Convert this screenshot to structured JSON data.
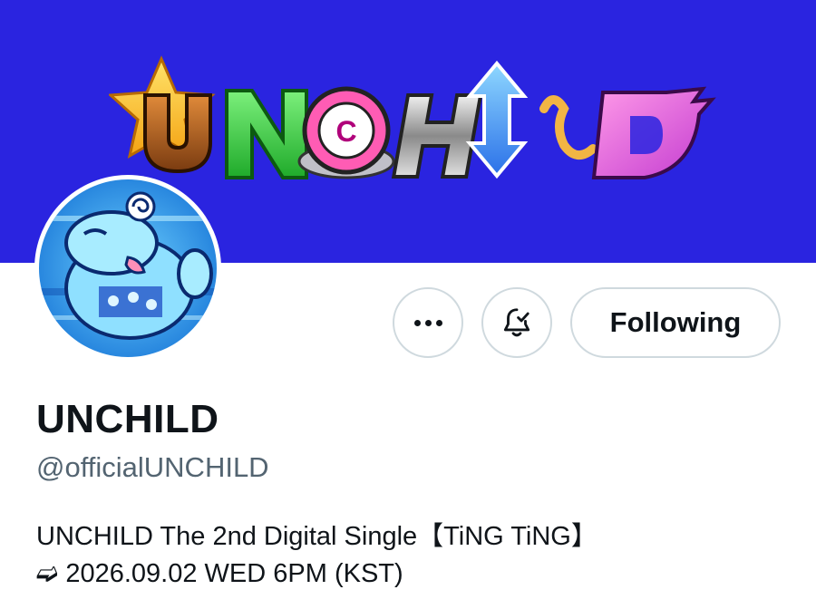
{
  "banner": {
    "logo_text": "UNCHILD",
    "background_color": "#2a24e0"
  },
  "profile": {
    "display_name": "UNCHILD",
    "handle": "@officialUNCHILD",
    "bio_line_1": "UNCHILD The 2nd Digital Single【TiNG TiNG】",
    "bio_line_2": "➫ 2026.09.02 WED 6PM (KST)"
  },
  "actions": {
    "more_icon": "more-horizontal-icon",
    "notify_icon": "bell-check-icon",
    "following_label": "Following"
  },
  "colors": {
    "text_primary": "#0f1419",
    "text_secondary": "#536471",
    "border": "#cfd9de"
  }
}
